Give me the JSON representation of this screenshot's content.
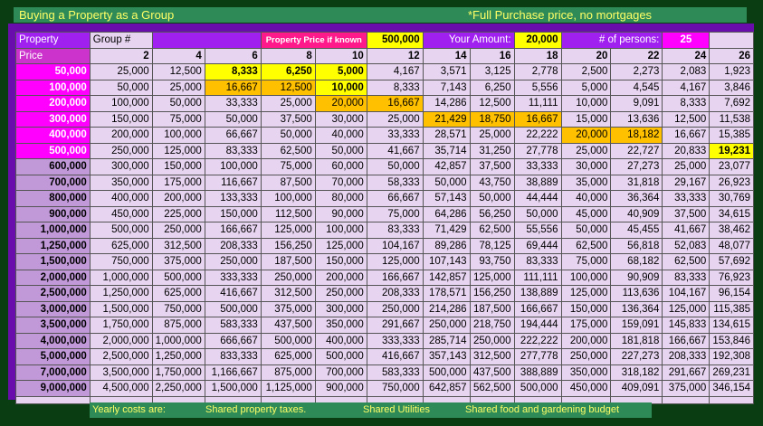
{
  "title": "Buying a Property as a Group",
  "note": "*Full Purchase price, no mortgages",
  "labels": {
    "property": "Property",
    "group": "Group #",
    "price": "Price",
    "price_if_known": "Property Price if known",
    "price_value": "500,000",
    "your_amount": "Your Amount:",
    "your_amount_value": "20,000",
    "num_persons": "# of persons:",
    "num_persons_value": "25"
  },
  "group_sizes": [
    "2",
    "4",
    "6",
    "8",
    "10",
    "12",
    "14",
    "16",
    "18",
    "20",
    "22",
    "24",
    "26"
  ],
  "rows": [
    {
      "price": "50,000",
      "label_style": "pink",
      "cells": [
        "25,000",
        "12,500",
        "8,333",
        "6,250",
        "5,000",
        "4,167",
        "3,571",
        "3,125",
        "2,778",
        "2,500",
        "2,273",
        "2,083",
        "1,923"
      ]
    },
    {
      "price": "100,000",
      "label_style": "pink",
      "cells": [
        "50,000",
        "25,000",
        "16,667",
        "12,500",
        "10,000",
        "8,333",
        "7,143",
        "6,250",
        "5,556",
        "5,000",
        "4,545",
        "4,167",
        "3,846"
      ]
    },
    {
      "price": "200,000",
      "label_style": "pink",
      "cells": [
        "100,000",
        "50,000",
        "33,333",
        "25,000",
        "20,000",
        "16,667",
        "14,286",
        "12,500",
        "11,111",
        "10,000",
        "9,091",
        "8,333",
        "7,692"
      ]
    },
    {
      "price": "300,000",
      "label_style": "pink",
      "cells": [
        "150,000",
        "75,000",
        "50,000",
        "37,500",
        "30,000",
        "25,000",
        "21,429",
        "18,750",
        "16,667",
        "15,000",
        "13,636",
        "12,500",
        "11,538"
      ]
    },
    {
      "price": "400,000",
      "label_style": "pink",
      "cells": [
        "200,000",
        "100,000",
        "66,667",
        "50,000",
        "40,000",
        "33,333",
        "28,571",
        "25,000",
        "22,222",
        "20,000",
        "18,182",
        "16,667",
        "15,385"
      ]
    },
    {
      "price": "500,000",
      "label_style": "pink",
      "cells": [
        "250,000",
        "125,000",
        "83,333",
        "62,500",
        "50,000",
        "41,667",
        "35,714",
        "31,250",
        "27,778",
        "25,000",
        "22,727",
        "20,833",
        "19,231"
      ]
    },
    {
      "price": "600,000",
      "label_style": "purp",
      "cells": [
        "300,000",
        "150,000",
        "100,000",
        "75,000",
        "60,000",
        "50,000",
        "42,857",
        "37,500",
        "33,333",
        "30,000",
        "27,273",
        "25,000",
        "23,077"
      ]
    },
    {
      "price": "700,000",
      "label_style": "purp",
      "cells": [
        "350,000",
        "175,000",
        "116,667",
        "87,500",
        "70,000",
        "58,333",
        "50,000",
        "43,750",
        "38,889",
        "35,000",
        "31,818",
        "29,167",
        "26,923"
      ]
    },
    {
      "price": "800,000",
      "label_style": "purp",
      "cells": [
        "400,000",
        "200,000",
        "133,333",
        "100,000",
        "80,000",
        "66,667",
        "57,143",
        "50,000",
        "44,444",
        "40,000",
        "36,364",
        "33,333",
        "30,769"
      ]
    },
    {
      "price": "900,000",
      "label_style": "purp",
      "cells": [
        "450,000",
        "225,000",
        "150,000",
        "112,500",
        "90,000",
        "75,000",
        "64,286",
        "56,250",
        "50,000",
        "45,000",
        "40,909",
        "37,500",
        "34,615"
      ]
    },
    {
      "price": "1,000,000",
      "label_style": "purp",
      "cells": [
        "500,000",
        "250,000",
        "166,667",
        "125,000",
        "100,000",
        "83,333",
        "71,429",
        "62,500",
        "55,556",
        "50,000",
        "45,455",
        "41,667",
        "38,462"
      ]
    },
    {
      "price": "1,250,000",
      "label_style": "purp",
      "cells": [
        "625,000",
        "312,500",
        "208,333",
        "156,250",
        "125,000",
        "104,167",
        "89,286",
        "78,125",
        "69,444",
        "62,500",
        "56,818",
        "52,083",
        "48,077"
      ]
    },
    {
      "price": "1,500,000",
      "label_style": "purp",
      "cells": [
        "750,000",
        "375,000",
        "250,000",
        "187,500",
        "150,000",
        "125,000",
        "107,143",
        "93,750",
        "83,333",
        "75,000",
        "68,182",
        "62,500",
        "57,692"
      ]
    },
    {
      "price": "2,000,000",
      "label_style": "purp",
      "cells": [
        "1,000,000",
        "500,000",
        "333,333",
        "250,000",
        "200,000",
        "166,667",
        "142,857",
        "125,000",
        "111,111",
        "100,000",
        "90,909",
        "83,333",
        "76,923"
      ]
    },
    {
      "price": "2,500,000",
      "label_style": "purp",
      "cells": [
        "1,250,000",
        "625,000",
        "416,667",
        "312,500",
        "250,000",
        "208,333",
        "178,571",
        "156,250",
        "138,889",
        "125,000",
        "113,636",
        "104,167",
        "96,154"
      ]
    },
    {
      "price": "3,000,000",
      "label_style": "purp",
      "cells": [
        "1,500,000",
        "750,000",
        "500,000",
        "375,000",
        "300,000",
        "250,000",
        "214,286",
        "187,500",
        "166,667",
        "150,000",
        "136,364",
        "125,000",
        "115,385"
      ]
    },
    {
      "price": "3,500,000",
      "label_style": "purp",
      "cells": [
        "1,750,000",
        "875,000",
        "583,333",
        "437,500",
        "350,000",
        "291,667",
        "250,000",
        "218,750",
        "194,444",
        "175,000",
        "159,091",
        "145,833",
        "134,615"
      ]
    },
    {
      "price": "4,000,000",
      "label_style": "purp",
      "cells": [
        "2,000,000",
        "1,000,000",
        "666,667",
        "500,000",
        "400,000",
        "333,333",
        "285,714",
        "250,000",
        "222,222",
        "200,000",
        "181,818",
        "166,667",
        "153,846"
      ]
    },
    {
      "price": "5,000,000",
      "label_style": "purp",
      "cells": [
        "2,500,000",
        "1,250,000",
        "833,333",
        "625,000",
        "500,000",
        "416,667",
        "357,143",
        "312,500",
        "277,778",
        "250,000",
        "227,273",
        "208,333",
        "192,308"
      ]
    },
    {
      "price": "7,000,000",
      "label_style": "purp",
      "cells": [
        "3,500,000",
        "1,750,000",
        "1,166,667",
        "875,000",
        "700,000",
        "583,333",
        "500,000",
        "437,500",
        "388,889",
        "350,000",
        "318,182",
        "291,667",
        "269,231"
      ]
    },
    {
      "price": "9,000,000",
      "label_style": "purp",
      "cells": [
        "4,500,000",
        "2,250,000",
        "1,500,000",
        "1,125,000",
        "900,000",
        "750,000",
        "642,857",
        "562,500",
        "500,000",
        "450,000",
        "409,091",
        "375,000",
        "346,154"
      ]
    }
  ],
  "highlights": {
    "yellow": [
      "0-2",
      "0-3",
      "0-4",
      "1-4",
      "5-12"
    ],
    "orange": [
      "1-2",
      "1-3",
      "2-4",
      "2-5",
      "3-6",
      "3-7",
      "3-8",
      "4-9",
      "4-10"
    ]
  },
  "footer": {
    "yearly": "Yearly costs are:",
    "taxes": "Shared property taxes.",
    "utilities": "Shared Utilities",
    "food": "Shared food and gardening budget"
  },
  "colors": {
    "background": "#0b3d12",
    "title_bar": "#2e8b57",
    "frame": "#6a0dad",
    "highlight_yellow": "#ffff00",
    "highlight_orange": "#ffc000",
    "price_pink": "#ff00ff"
  }
}
